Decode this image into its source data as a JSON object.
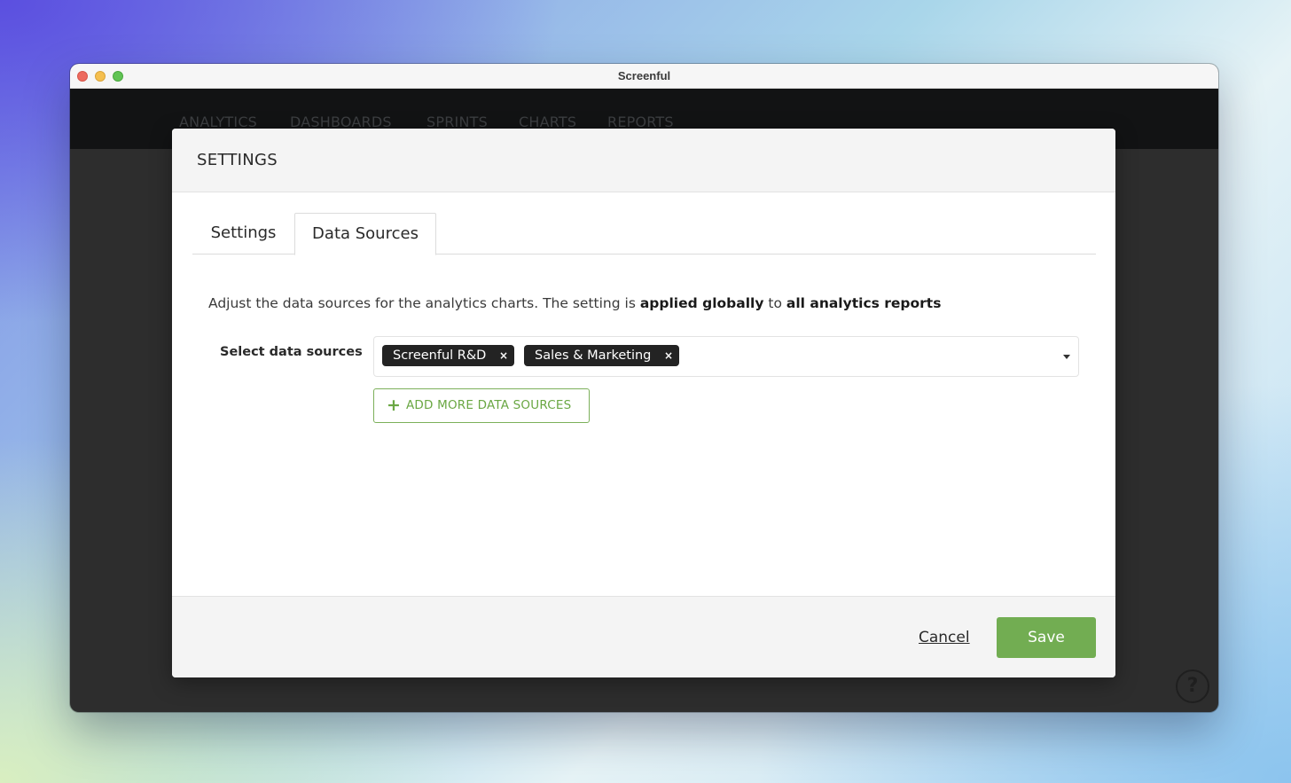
{
  "window": {
    "title": "Screenful"
  },
  "navbar": {
    "items": [
      {
        "label": "ANALYTICS"
      },
      {
        "label": "DASHBOARDS"
      },
      {
        "label": "SPRINTS"
      },
      {
        "label": "CHARTS"
      },
      {
        "label": "REPORTS"
      }
    ]
  },
  "modal": {
    "title": "SETTINGS",
    "tabs": [
      {
        "label": "Settings",
        "active": false
      },
      {
        "label": "Data Sources",
        "active": true
      }
    ],
    "description": {
      "part1": "Adjust the data sources for the analytics charts. The setting is ",
      "bold1": "applied globally",
      "part2": " to ",
      "bold2": "all analytics reports"
    },
    "data_sources": {
      "label": "Select data sources",
      "selected": [
        {
          "label": "Screenful R&D",
          "remove": "×"
        },
        {
          "label": "Sales & Marketing",
          "remove": "×"
        }
      ],
      "add_icon": "+",
      "add_label": "ADD MORE DATA SOURCES"
    },
    "footer": {
      "cancel_label": "Cancel",
      "save_label": "Save"
    }
  },
  "help": {
    "label": "?"
  },
  "colors": {
    "accent_green": "#72ad52",
    "chip_bg": "#232323",
    "navbar_bg": "#121314"
  }
}
